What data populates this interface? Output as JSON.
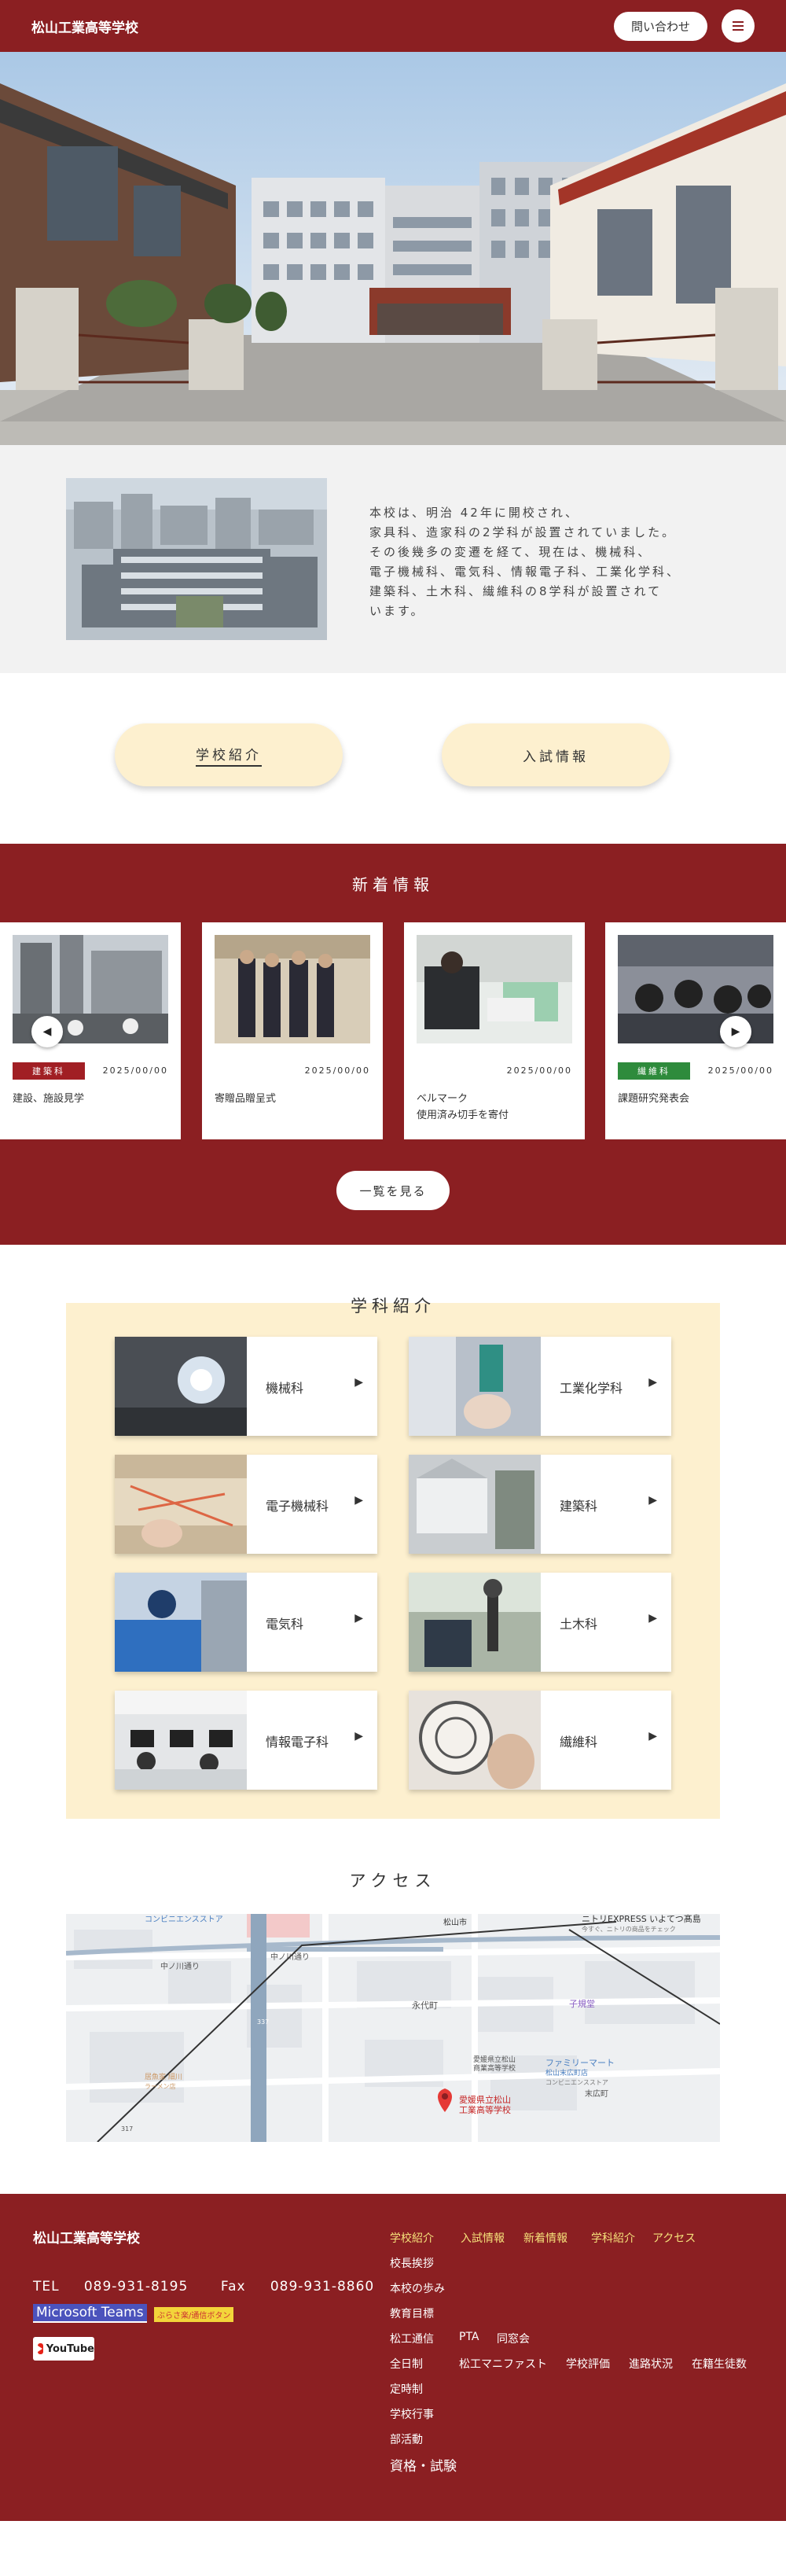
{
  "header": {
    "site_title": "松山工業高等学校",
    "contact_label": "問い合わせ"
  },
  "intro": {
    "text": "本校は、明治 42年に開校され、\n家具科、造家科の2学科が設置されていました。\nその後幾多の変遷を経て、現在は、機械科、\n電子機械科、電気科、情報電子科、工業化学科、\n建築科、土木科、繊維科の8学科が設置されて\nいます。"
  },
  "cta": {
    "school_intro": "学校紹介",
    "admissions": "入試情報"
  },
  "news": {
    "title": "新着情報",
    "items": [
      {
        "tag": "建築科",
        "tag_color": "#a11f24",
        "date": "2025/00/00",
        "title": "建設、施設見学"
      },
      {
        "tag": "",
        "tag_color": "",
        "date": "2025/00/00",
        "title": "寄贈品贈呈式"
      },
      {
        "tag": "",
        "tag_color": "",
        "date": "2025/00/00",
        "title": "ベルマーク\n使用済み切手を寄付"
      },
      {
        "tag": "繊維科",
        "tag_color": "#2e8b3c",
        "date": "2025/00/00",
        "title": "課題研究発表会"
      }
    ],
    "more_label": "一覧を見る"
  },
  "departments": {
    "title": "学科紹介",
    "items": [
      {
        "name": "機械科"
      },
      {
        "name": "工業化学科"
      },
      {
        "name": "電子機械科"
      },
      {
        "name": "建築科"
      },
      {
        "name": "電気科"
      },
      {
        "name": "土木科"
      },
      {
        "name": "情報電子科"
      },
      {
        "name": "繊維科"
      }
    ]
  },
  "access": {
    "title": "アクセス",
    "map_labels": {
      "conv1": "コンビニエンスストア",
      "naka1": "中ノ川通り",
      "naka2": "中ノ川通り",
      "matsuyama": "松山市",
      "nitori": "ニトリEXPRESS いよてつ髙島",
      "nitori_sub": "今すぐ、ニトリの商品をチェック",
      "eimachi": "永代町",
      "shoshi": "子規堂",
      "famima": "ファミリーマート",
      "famima_sub": "松山末広町店",
      "famima_sub2": "コンビニエンスストア",
      "suehiro": "末広町",
      "school": "愛媛県立松山\n工業高等学校",
      "route": "337",
      "route2": "317",
      "label_sea": "愛媛県立松山\n商業高等学校",
      "ramen": "居魚家 細川",
      "ramen_sub": "ラーメン店"
    }
  },
  "footer": {
    "name": "松山工業高等学校",
    "tel_label": "TEL",
    "tel": "089-931-8195",
    "fax_label": "Fax",
    "fax": "089-931-8860",
    "teams": "Microsoft Teams",
    "fumuse": "ぶらさ楽/通信ボタン",
    "youtube": "YouTube",
    "nav_top": [
      "学校紹介",
      "入試情報",
      "新着情報",
      "学科紹介",
      "アクセス"
    ],
    "links": [
      "校長挨拶",
      "本校の歩み",
      "教育目標",
      "松工通信",
      "PTA",
      "同窓会",
      "全日制",
      "松工マニファスト",
      "学校評価",
      "進路状況",
      "在籍生徒数",
      "定時制",
      "学校行事",
      "部活動"
    ],
    "big_link": "資格・試験"
  },
  "colors": {
    "brand": "#8b1f22",
    "cream": "#fdf0cf",
    "tag_red": "#a11f24",
    "tag_green": "#2e8b3c"
  }
}
